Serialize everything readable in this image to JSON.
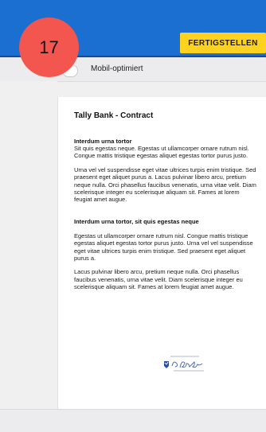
{
  "toolbar": {
    "finish_label": "FERTIGSTELLEN"
  },
  "badge": {
    "step": "17"
  },
  "toggle": {
    "label": "Mobil-optimiert",
    "on": false
  },
  "document": {
    "title": "Tally Bank - Contract",
    "section1": {
      "heading": "Interdum urna tortor",
      "p1": "Sit quis egestas neque. Egestas ut ullamcorper ornare rutrum nisl. Congue mattis tristique egestas aliquet egestas tortor purus justo.",
      "p2": "Urna vel vel suspendisse eget vitae ultrices turpis enim tristique. Sed praesent eget aliquet purus a. Lacus pulvinar libero arcu, pretium neque nulla. Orci phasellus faucibus venenatis, urna vitae velit. Diam scelerisque integer eu scelerisque aliquam sit. Fames at lorem feugiat amet augue."
    },
    "section2": {
      "heading": "Interdum urna tortor, sit quis egestas neque",
      "p1": " Egestas ut ullamcorper ornare rutrum nisl. Congue mattis tristique egestas aliquet egestas tortor purus justo. Urna vel vel suspendisse eget vitae ultrices turpis enim tristique. Sed praesent eget aliquet purus a.",
      "p2": "Lacus pulvinar libero arcu, pretium neque nulla. Orci phasellus faucibus venenatis, urna vitae velit. Diam scelerisque integer eu scelerisque aliquam sit. Fames at lorem feugiat amet augue."
    },
    "signature": {
      "type": "handwritten-signature-stamp"
    }
  },
  "colors": {
    "topbar": "#1b6fd1",
    "button": "#ffd21f",
    "badge": "#f2564e"
  }
}
